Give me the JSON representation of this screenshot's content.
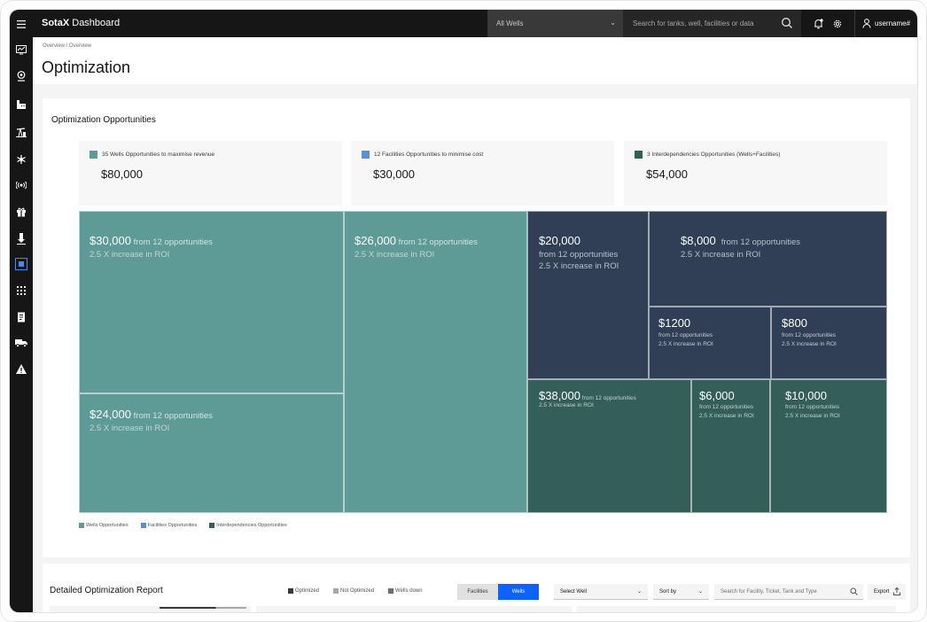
{
  "header": {
    "brand_bold": "SotaX",
    "brand_rest": " Dashboard",
    "wells_select": "All Wells",
    "search_placeholder": "Search for tanks, well, facilities or data",
    "username": "username#"
  },
  "sidebar": {
    "items": [
      {
        "icon": "menu-icon"
      },
      {
        "icon": "monitor-chart-icon"
      },
      {
        "icon": "location-pin-icon"
      },
      {
        "icon": "factory-icon"
      },
      {
        "icon": "pump-jack-icon"
      },
      {
        "icon": "asterisk-network-icon"
      },
      {
        "icon": "signal-icon"
      },
      {
        "icon": "gift-icon"
      },
      {
        "icon": "download-tower-icon"
      },
      {
        "icon": "optimization-icon",
        "active": true
      },
      {
        "icon": "grid-icon"
      },
      {
        "icon": "document-icon"
      },
      {
        "icon": "truck-icon"
      },
      {
        "icon": "warning-icon"
      }
    ]
  },
  "page": {
    "breadcrumb": "Overview  / Overview",
    "title": "Optimization"
  },
  "opportunities": {
    "title": "Optimization Opportunities",
    "summaries": [
      {
        "label": "35 Wells Opportunities to maximise revenue",
        "amount": "$80,000",
        "color": "#5e9a96"
      },
      {
        "label": "12 Facilities Opportunities to minimise cost",
        "amount": "$30,000",
        "color": "#5b8fdb"
      },
      {
        "label": "3 Interdependencies Opportunities (Wells+Facilities)",
        "amount": "$54,000",
        "color": "#335e5a"
      }
    ],
    "colors": {
      "wells": "#5e9a96",
      "facilities": "#303f55",
      "interdependencies": "#335e5a"
    },
    "tiles": [
      {
        "amount": "$30,000",
        "from": " from 12 opportunities",
        "roi": "2.5 X increase in ROI"
      },
      {
        "amount": "$24,000",
        "from": " from 12 opportunities",
        "roi": "2.5 X increase in ROI"
      },
      {
        "amount": "$26,000",
        "from": " from 12 opportunities",
        "roi": "2.5 X increase in ROI"
      },
      {
        "amount": "$20,000",
        "from": "from 12 opportunities",
        "roi": "2.5 X increase in ROI"
      },
      {
        "amount": "$8,000",
        "from": "from 12 opportunities",
        "roi": "2.5 X increase in ROI"
      },
      {
        "amount": "$1200",
        "from": "from 12 opportunities",
        "roi": "2.5 X increase in ROI"
      },
      {
        "amount": "$800",
        "from": "from 12 opportunities",
        "roi": "2.5 X increase in ROI"
      },
      {
        "amount": "$38,000",
        "from": " from 12 opportunities",
        "roi": "2.5 X increase in ROI"
      },
      {
        "amount": "$6,000",
        "from": "from 12 opportunities",
        "roi": "2.5 X increase in ROI"
      },
      {
        "amount": "$10,000",
        "from": "from 12 opportunities",
        "roi": "2.5 X increase in ROI"
      }
    ],
    "legend": [
      "Wells Opportunities",
      "Facilities Opportunities",
      "Interdependencies Opportunities"
    ]
  },
  "report": {
    "title": "Detailed Optimization Report",
    "status_legend": [
      {
        "label": "Optimized",
        "color": "#393939"
      },
      {
        "label": "Not Optimized",
        "color": "#a8a8a8"
      },
      {
        "label": "Wells down",
        "color": "#6f6f6f"
      }
    ],
    "toggle": [
      "Facilities",
      "Wells"
    ],
    "toggle_selected": "Wells",
    "select_well": "Select Well",
    "sort_by": "Sort by",
    "search_placeholder": "Search for Facility, Ticket, Tank and Type",
    "export": "Export"
  }
}
